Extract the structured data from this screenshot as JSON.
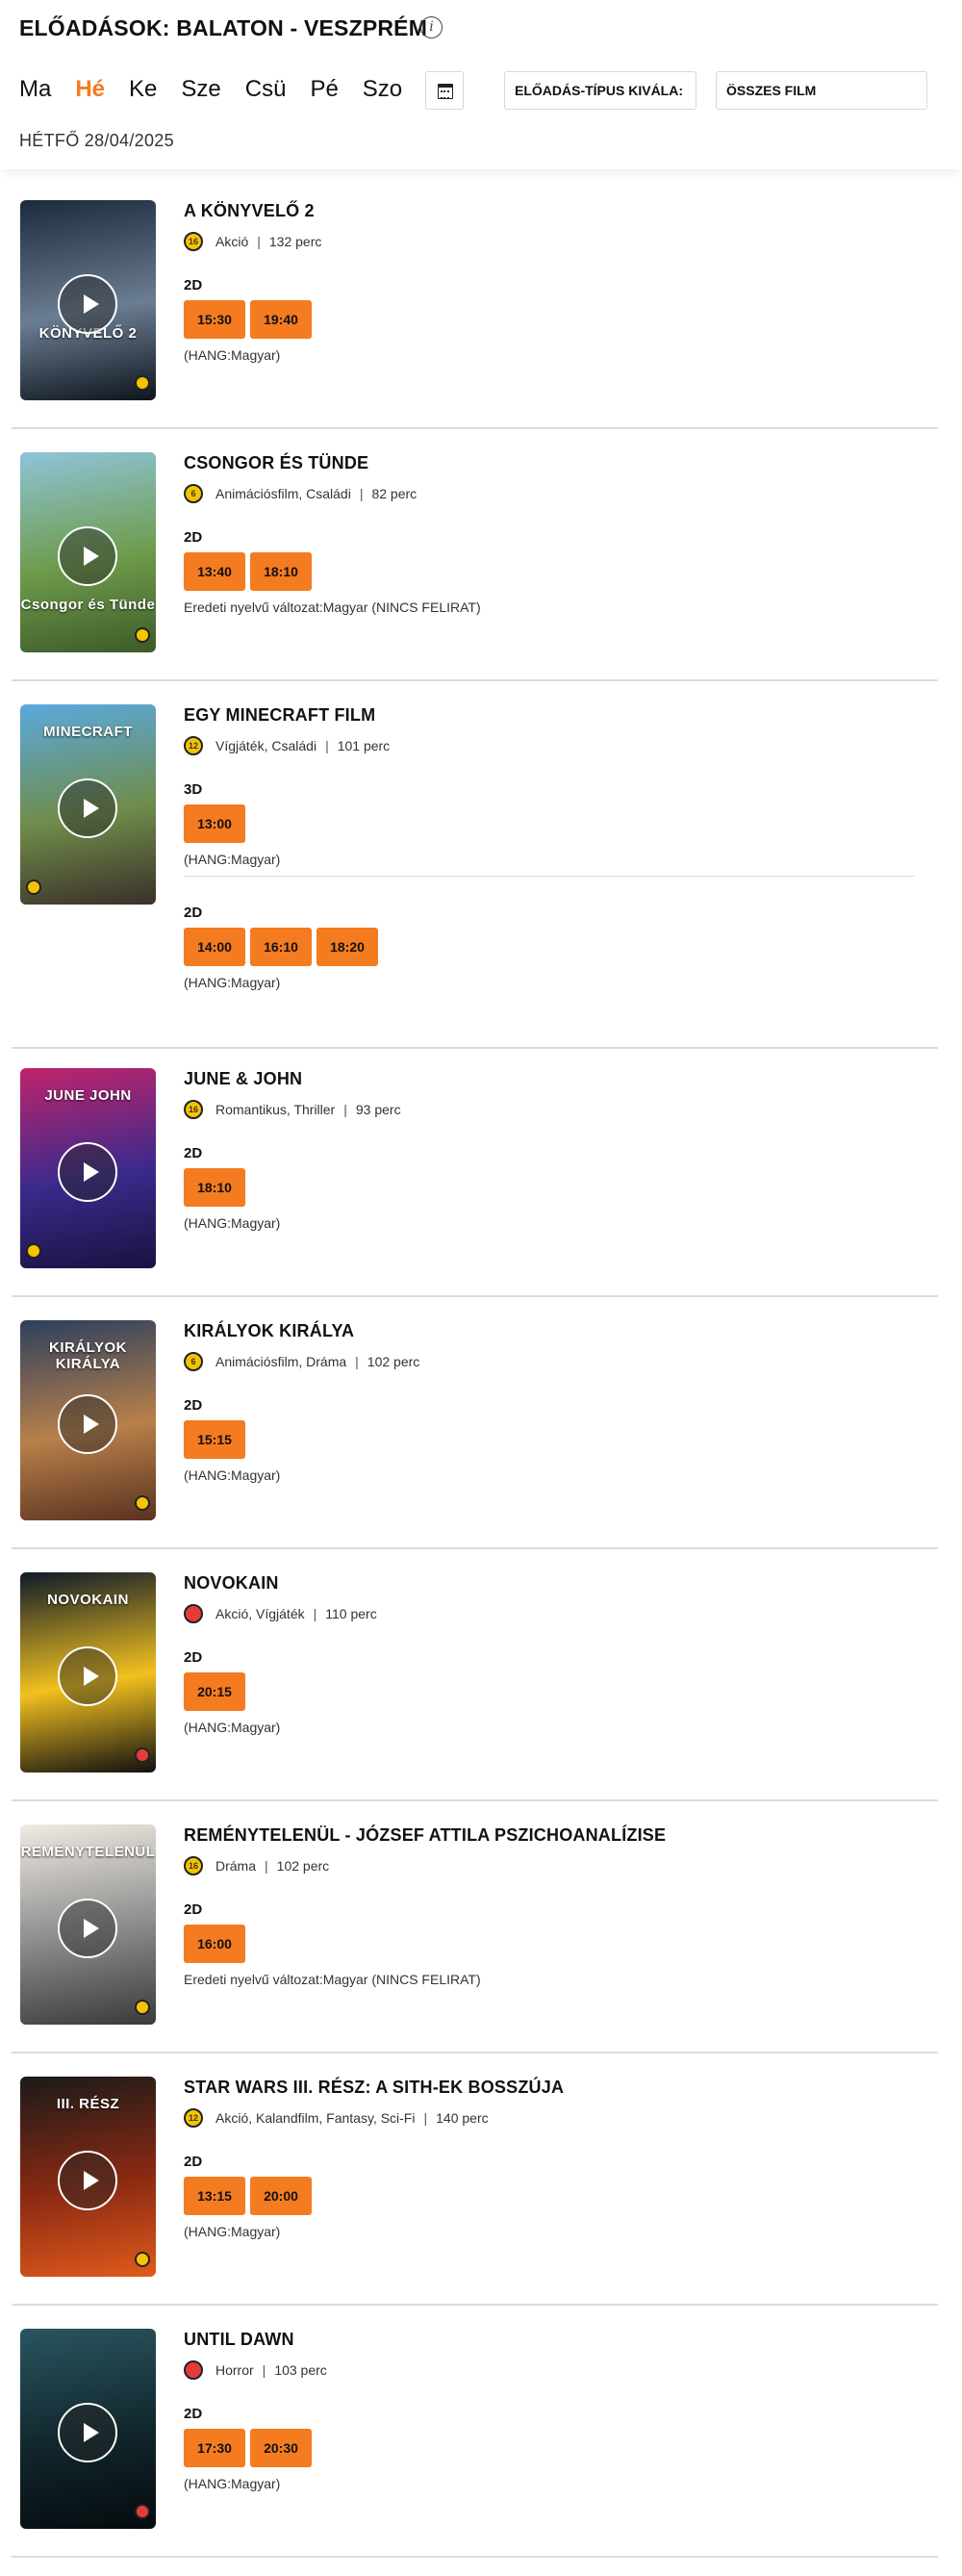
{
  "header": {
    "title": "ELŐADÁSOK: BALATON - VESZPRÉM",
    "info_icon": "info-icon",
    "days": [
      "Ma",
      "Hé",
      "Ke",
      "Sze",
      "Csü",
      "Pé",
      "Szo"
    ],
    "active_day": "Hé",
    "calendar_icon": "calendar-icon",
    "type_select": "ELŐADÁS-TÍPUS KIVÁLA:",
    "film_select": "ÖSSZES FILM",
    "date": "HÉTFŐ 28/04/2025"
  },
  "films": [
    {
      "title": "A KÖNYVELŐ 2",
      "rating": "16",
      "genre": "Akció",
      "duration": "132 perc",
      "versions": [
        {
          "format": "2D",
          "times": [
            "15:30",
            "19:40"
          ],
          "language": "(HANG:Magyar)"
        }
      ],
      "poster_title": "KÖNYVELŐ 2",
      "poster_colors": [
        "#1c2a3c",
        "#6b7d92",
        "#0e151e"
      ]
    },
    {
      "title": "CSONGOR ÉS TÜNDE",
      "rating": "6",
      "genre": "Animációsfilm, Családi",
      "duration": "82 perc",
      "versions": [
        {
          "format": "2D",
          "times": [
            "13:40",
            "18:10"
          ],
          "language": "Eredeti nyelvű változat:Magyar (NINCS FELIRAT)"
        }
      ],
      "poster_title": "Csongor és Tünde",
      "poster_colors": [
        "#8fc4d9",
        "#6e9b4a",
        "#3d5a2a"
      ]
    },
    {
      "title": "EGY MINECRAFT FILM",
      "rating": "12",
      "genre": "Vígjáték, Családi",
      "duration": "101 perc",
      "versions": [
        {
          "format": "3D",
          "times": [
            "13:00"
          ],
          "language": "(HANG:Magyar)"
        },
        {
          "format": "2D",
          "times": [
            "14:00",
            "16:10",
            "18:20"
          ],
          "language": "(HANG:Magyar)"
        }
      ],
      "poster_title": "MINECRAFT",
      "poster_colors": [
        "#5aa9df",
        "#6f8c4a",
        "#3b2f2a"
      ]
    },
    {
      "title": "JUNE & JOHN",
      "rating": "16",
      "genre": "Romantikus, Thriller",
      "duration": "93 perc",
      "versions": [
        {
          "format": "2D",
          "times": [
            "18:10"
          ],
          "language": "(HANG:Magyar)"
        }
      ],
      "poster_title": "JUNE JOHN",
      "poster_colors": [
        "#c0246b",
        "#3a2a8c",
        "#1a1240"
      ]
    },
    {
      "title": "KIRÁLYOK KIRÁLYA",
      "rating": "6",
      "genre": "Animációsfilm, Dráma",
      "duration": "102 perc",
      "versions": [
        {
          "format": "2D",
          "times": [
            "15:15"
          ],
          "language": "(HANG:Magyar)"
        }
      ],
      "poster_title": "KIRÁLYOK KIRÁLYA",
      "poster_colors": [
        "#2c3f5e",
        "#b8804a",
        "#5a3220"
      ]
    },
    {
      "title": "NOVOKAIN",
      "rating": "18",
      "genre": "Akció, Vígjáték",
      "duration": "110 perc",
      "versions": [
        {
          "format": "2D",
          "times": [
            "20:15"
          ],
          "language": "(HANG:Magyar)"
        }
      ],
      "poster_title": "NOVOKAIN",
      "poster_colors": [
        "#0d1a2a",
        "#f2c01e",
        "#111111"
      ]
    },
    {
      "title": "REMÉNYTELENÜL - JÓZSEF ATTILA PSZICHOANALÍZISE",
      "rating": "16",
      "genre": "Dráma",
      "duration": "102 perc",
      "versions": [
        {
          "format": "2D",
          "times": [
            "16:00"
          ],
          "language": "Eredeti nyelvű változat:Magyar (NINCS FELIRAT)"
        }
      ],
      "poster_title": "REMÉNYTELENÜL",
      "poster_colors": [
        "#f0ebe3",
        "#8a8a8a",
        "#3a3a3a"
      ]
    },
    {
      "title": "STAR WARS III. RÉSZ: A SITH-EK BOSSZÚJA",
      "rating": "12",
      "genre": "Akció, Kalandfilm, Fantasy, Sci-Fi",
      "duration": "140 perc",
      "versions": [
        {
          "format": "2D",
          "times": [
            "13:15",
            "20:00"
          ],
          "language": "(HANG:Magyar)"
        }
      ],
      "poster_title": "III. RÉSZ",
      "poster_colors": [
        "#1a1a1a",
        "#8c2a12",
        "#e05a1c"
      ]
    },
    {
      "title": "UNTIL DAWN",
      "rating": "18",
      "genre": "Horror",
      "duration": "103 perc",
      "versions": [
        {
          "format": "2D",
          "times": [
            "17:30",
            "20:30"
          ],
          "language": "(HANG:Magyar)"
        }
      ],
      "poster_title": "",
      "poster_colors": [
        "#2a5560",
        "#11262c",
        "#050b0e"
      ]
    }
  ]
}
